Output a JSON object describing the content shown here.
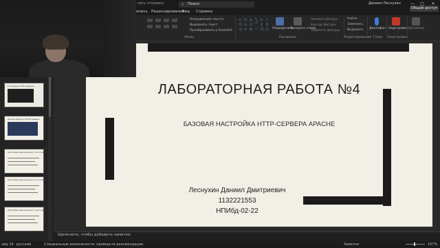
{
  "titlebar": {
    "qa_text": "нить отправку",
    "search_label": "Поиск",
    "user": "Даниил Леснухин",
    "minimize": "—",
    "maximize": "□",
    "close": "✕"
  },
  "tabs": [
    {
      "label": "апись"
    },
    {
      "label": "Рецензирование"
    },
    {
      "label": "Вид"
    },
    {
      "label": "Справка"
    }
  ],
  "share_label": "Общий доступ",
  "ribbon": {
    "paragraph_label": "Абзац",
    "drawing_label": "Рисование",
    "editing_label": "Редактирование",
    "voice_label": "Голос",
    "addins_label": "Надстройки",
    "direction_text": "Направление текста",
    "align_text": "Выровнять текст",
    "smartart": "Преобразовать в SmartArt",
    "arrange": "Упорядочить",
    "quick_styles": "Экспресс-стили",
    "shape_fill": "Заливка фигуры",
    "shape_outline": "Контур фигуры",
    "shape_effects": "Эффекты фигуры",
    "find": "Найти",
    "replace": "Заменить",
    "select": "Выделить",
    "dictate": "Диктофон",
    "addins": "Надстройки",
    "designer": "Дизайнер"
  },
  "thumbnails": [
    {
      "num": "",
      "caption": "Установка HTTP-сервера"
    },
    {
      "num": "",
      "caption": "Анализ работы HTTP-сервера"
    },
    {
      "num": "",
      "caption": "Настройка виртуального хостинга для HTTP-сервера"
    },
    {
      "num": "",
      "caption": "Настройка виртуального хостинга для HTTP-сервера"
    },
    {
      "num": "",
      "caption": "Настройка виртуального хостинга для HTTP-сервера"
    }
  ],
  "slide": {
    "title": "ЛАБОРАТОРНАЯ РАБОТА №4",
    "subtitle": "БАЗОВАЯ НАСТРОЙКА HTTP-СЕРВЕРА APACHE",
    "author": "Леснухин Даниил Дмитриевич",
    "student_id": "1132221553",
    "group": "НПИбд-02-22"
  },
  "notes_placeholder": "Щелкните, чтобы добавить заметки",
  "status": {
    "slide_info": "айд 16",
    "language": "русский",
    "accessibility": "Специальные возможности: проверьте рекомендации",
    "notes": "Заметки",
    "zoom": "107%"
  }
}
